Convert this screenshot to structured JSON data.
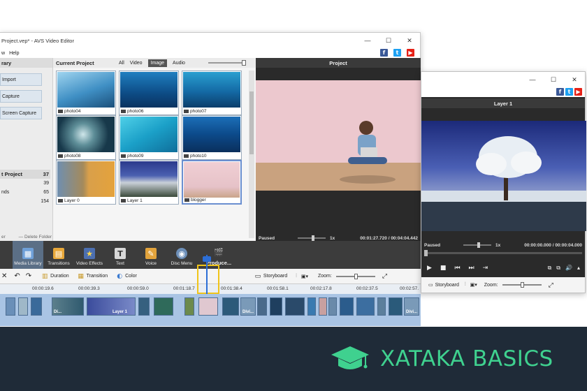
{
  "main_window": {
    "title": "Project.vep* - AVS Video Editor",
    "menu": [
      "w",
      "Help"
    ],
    "social": [
      "f",
      "t",
      "▶"
    ],
    "window_controls": [
      "—",
      "☐",
      "✕"
    ]
  },
  "library": {
    "heading": "rary",
    "buttons": [
      "Import",
      "Capture",
      "Screen Capture"
    ],
    "project_header": {
      "label": "t Project",
      "count": "37"
    },
    "rows": [
      {
        "label": "",
        "count": "39"
      },
      {
        "label": "nds",
        "count": "65"
      },
      {
        "label": "",
        "count": "154"
      }
    ],
    "bottom_left": "er",
    "delete_folder": "— Delete Folder"
  },
  "media": {
    "title": "Current Project",
    "filters": [
      "All",
      "Video",
      "Image",
      "Audio"
    ],
    "active_filter": "Image",
    "thumbs": [
      {
        "label": "photo04"
      },
      {
        "label": "photo06"
      },
      {
        "label": "photo07"
      },
      {
        "label": "photo08"
      },
      {
        "label": "photo09"
      },
      {
        "label": "photo10"
      },
      {
        "label": "Layer 0"
      },
      {
        "label": "Layer 1"
      },
      {
        "label": "blogger"
      }
    ]
  },
  "preview": {
    "heading": "Project",
    "status": "Paused",
    "speed": "1x",
    "time": "00:01:27.720 / 00:04:04.442",
    "controls": [
      "▶",
      "■",
      "⏮",
      "⏭",
      "⇥"
    ],
    "right_controls": [
      "⧉",
      "⧉",
      "🔊",
      "▴"
    ]
  },
  "toolbar": {
    "items": [
      {
        "label": "Media Library",
        "icon": "▦",
        "color": "#6fa0d8"
      },
      {
        "label": "Transitions",
        "icon": "▤",
        "color": "#e8a83a"
      },
      {
        "label": "Video Effects",
        "icon": "★",
        "color": "#4c6fb0"
      },
      {
        "label": "Text",
        "icon": "T",
        "color": "#d8d8d8"
      },
      {
        "label": "Voice",
        "icon": "✎",
        "color": "#e2a33c"
      },
      {
        "label": "Disc Menu",
        "icon": "◉",
        "color": "#6d8fb8"
      },
      {
        "label": "Produce...",
        "icon": "🎬",
        "color": "#e6c547"
      }
    ]
  },
  "timeline": {
    "tools": [
      {
        "label": "Duration",
        "icon": "▥"
      },
      {
        "label": "Transition",
        "icon": "▦"
      },
      {
        "label": "Color",
        "icon": "◐"
      }
    ],
    "storyboard": "Storyboard",
    "zoom": "Zoom:",
    "ruler": [
      "00:00:19.6",
      "00:00:39.3",
      "00:00:59.0",
      "00:01:18.7",
      "00:01:38.4",
      "00:01:58.1",
      "00:02:17.8",
      "00:02:37.5",
      "00:02:57."
    ],
    "clip_labels": {
      "di1": "Di...",
      "layer1": "Layer 1",
      "di2": "Divi...",
      "di3": "Divi..."
    }
  },
  "second_window": {
    "heading": "Layer 1",
    "status": "Paused",
    "speed": "1x",
    "time": "00:00:00.000 / 00:00:04.000",
    "controls": [
      "▶",
      "■",
      "⏮",
      "⏭",
      "⇥"
    ],
    "right_controls": [
      "⧉",
      "⧉",
      "🔊",
      "▴"
    ],
    "storyboard": "Storyboard",
    "zoom": "Zoom:"
  },
  "brand": {
    "name": "XATAKA BASICS",
    "color": "#3fd18f",
    "background": "#1f2b38"
  }
}
